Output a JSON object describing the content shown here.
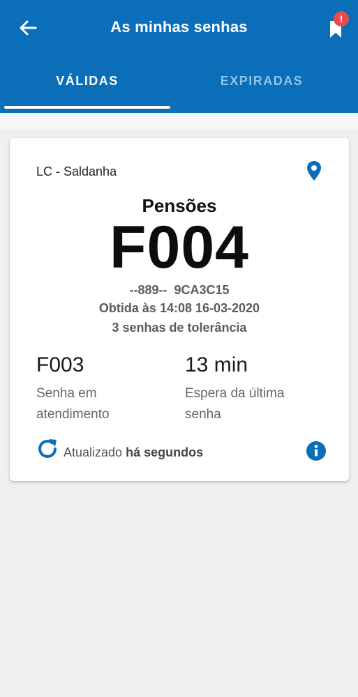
{
  "header": {
    "title": "As minhas senhas",
    "back_icon": "arrow-left-icon",
    "bookmark_icon": "bookmark-icon",
    "badge": "!",
    "colors": {
      "primary": "#0a6fb8",
      "badge": "#e84b4b"
    }
  },
  "tabs": [
    {
      "label": "VÁLIDAS",
      "active": true
    },
    {
      "label": "EXPIRADAS",
      "active": false
    }
  ],
  "card": {
    "location": "LC - Saldanha",
    "pin_icon": "location-pin-icon",
    "service": "Pensões",
    "ticket": "F004",
    "code": "--889--  9CA3C15",
    "obtained": "Obtida às 14:08 16-03-2020",
    "tolerance": "3 senhas de tolerância",
    "current": {
      "value": "F003",
      "label": "Senha em atendimento"
    },
    "wait": {
      "value": "13 min",
      "label": "Espera da última senha"
    },
    "updated_prefix": "Atualizado",
    "updated_time": "há segundos",
    "refresh_icon": "refresh-icon",
    "info_icon": "info-icon"
  }
}
